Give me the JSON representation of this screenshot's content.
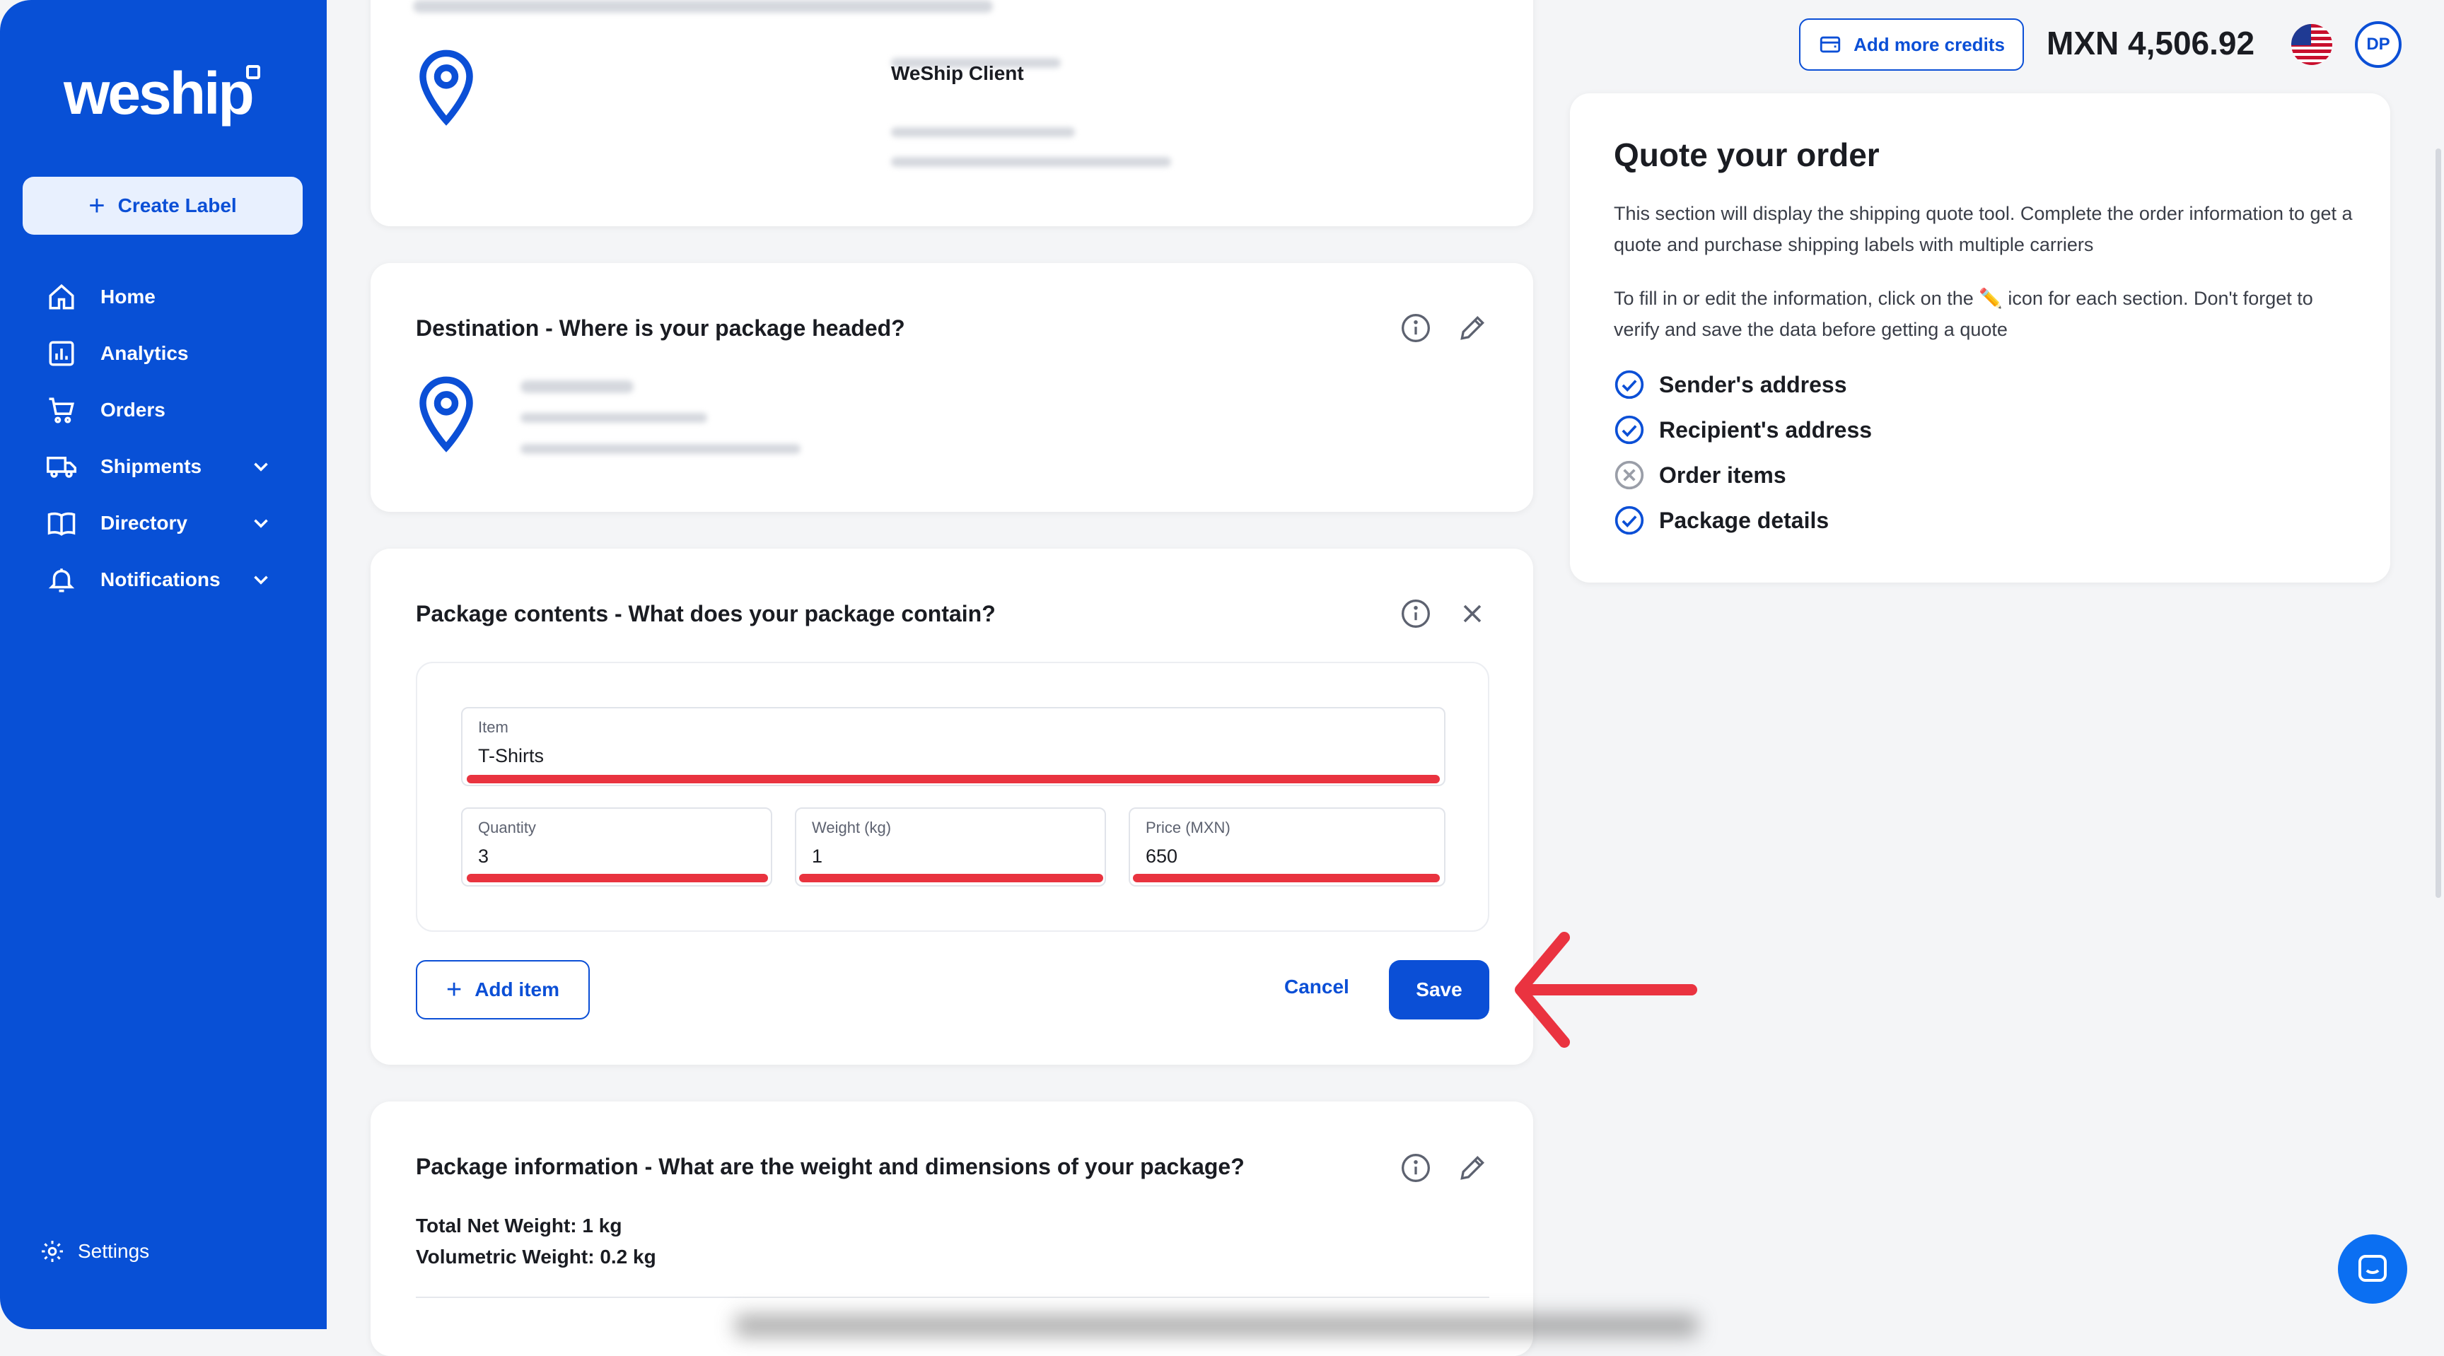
{
  "sidebar": {
    "logo": "weship",
    "create_label": "Create Label",
    "items": [
      {
        "label": "Home",
        "icon": "home-icon"
      },
      {
        "label": "Analytics",
        "icon": "analytics-icon"
      },
      {
        "label": "Orders",
        "icon": "cart-icon"
      },
      {
        "label": "Shipments",
        "icon": "truck-icon",
        "expandable": true
      },
      {
        "label": "Directory",
        "icon": "book-icon",
        "expandable": true
      },
      {
        "label": "Notifications",
        "icon": "bell-icon",
        "expandable": true
      }
    ],
    "settings": "Settings"
  },
  "topbar": {
    "add_credits": "Add more credits",
    "balance": "MXN 4,506.92",
    "avatar_initials": "DP"
  },
  "origin": {
    "client_name": "WeShip Client"
  },
  "destination": {
    "title": "Destination - Where is your package headed?"
  },
  "package_contents": {
    "title": "Package contents - What does your package contain?",
    "item_label": "Item",
    "item_value": "T-Shirts",
    "quantity_label": "Quantity",
    "quantity_value": "3",
    "weight_label": "Weight (kg)",
    "weight_value": "1",
    "price_label": "Price (MXN)",
    "price_value": "650",
    "add_item": "Add item",
    "cancel": "Cancel",
    "save": "Save"
  },
  "package_info": {
    "title": "Package information - What are the weight and dimensions of your package?",
    "net_weight": "Total Net Weight: 1 kg",
    "volumetric_weight": "Volumetric Weight: 0.2 kg"
  },
  "quote": {
    "title": "Quote your order",
    "p1": "This section will display the shipping quote tool. Complete the order information to get a quote and purchase shipping labels with multiple carriers",
    "p2": "To fill in or edit the information, click on the ✏️ icon for each section. Don't forget to verify and save the data before getting a quote",
    "checklist": [
      {
        "label": "Sender's address",
        "status": "done"
      },
      {
        "label": "Recipient's address",
        "status": "done"
      },
      {
        "label": "Order items",
        "status": "pending"
      },
      {
        "label": "Package details",
        "status": "done"
      }
    ]
  },
  "colors": {
    "brand": "#0850d6",
    "accent": "#0b4fd6",
    "highlight": "#e9333f"
  }
}
